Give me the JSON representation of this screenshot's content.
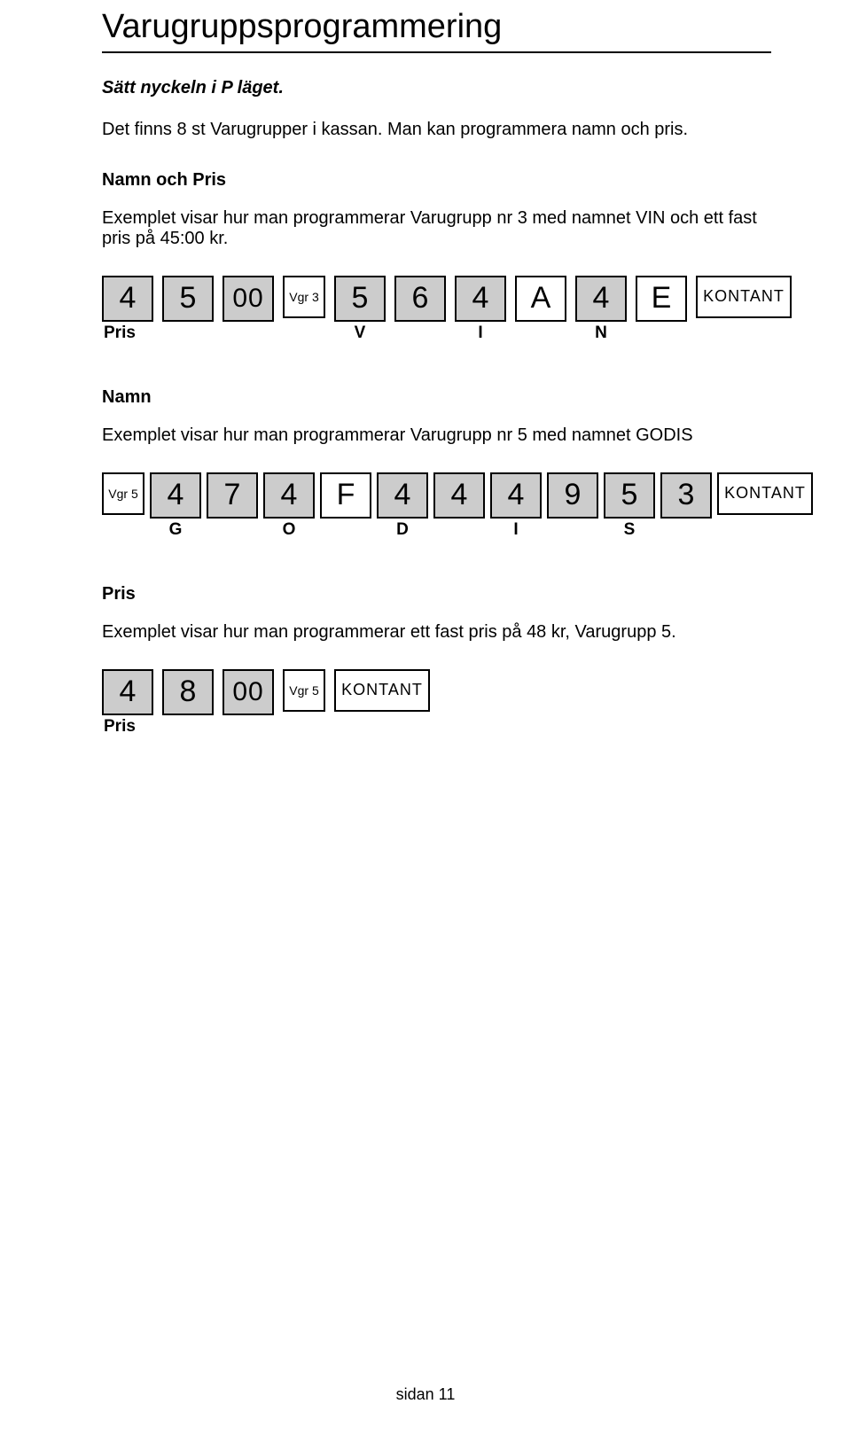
{
  "title": "Varugruppsprogrammering",
  "sub1": "Sätt nyckeln i P läget.",
  "sub2": "Det finns 8 st Varugrupper i kassan. Man kan programmera namn och pris.",
  "section1": {
    "heading": "Namn och Pris",
    "body": "Exemplet visar hur man programmerar Varugrupp nr 3 med namnet VIN och ett fast pris på 45:00 kr."
  },
  "row1": {
    "prisLabel": "Pris",
    "keys": {
      "k4": "4",
      "k5": "5",
      "k00": "00",
      "vgr3": "Vgr 3",
      "c5": "5",
      "c6": "6",
      "c4a": "4",
      "cA": "A",
      "c4b": "4",
      "cE": "E",
      "kontant": "KONTANT"
    },
    "letters": {
      "V": "V",
      "I": "I",
      "N": "N"
    }
  },
  "section2": {
    "heading": "Namn",
    "body": "Exemplet visar hur man programmerar Varugrupp nr 5 med namnet GODIS"
  },
  "row2": {
    "keys": {
      "vgr5": "Vgr 5",
      "k4a": "4",
      "k7": "7",
      "k4b": "4",
      "kF": "F",
      "k4c": "4",
      "k4d": "4",
      "k4e": "4",
      "k9": "9",
      "k5": "5",
      "k3": "3",
      "kontant": "KONTANT"
    },
    "letters": {
      "G": "G",
      "O": "O",
      "D": "D",
      "I": "I",
      "S": "S"
    }
  },
  "section3": {
    "heading": "Pris",
    "body": "Exemplet visar hur man programmerar ett fast pris på 48 kr, Varugrupp 5."
  },
  "row3": {
    "prisLabel": "Pris",
    "keys": {
      "k4": "4",
      "k8": "8",
      "k00": "00",
      "vgr5": "Vgr 5",
      "kontant": "KONTANT"
    }
  },
  "footer": "sidan 11"
}
